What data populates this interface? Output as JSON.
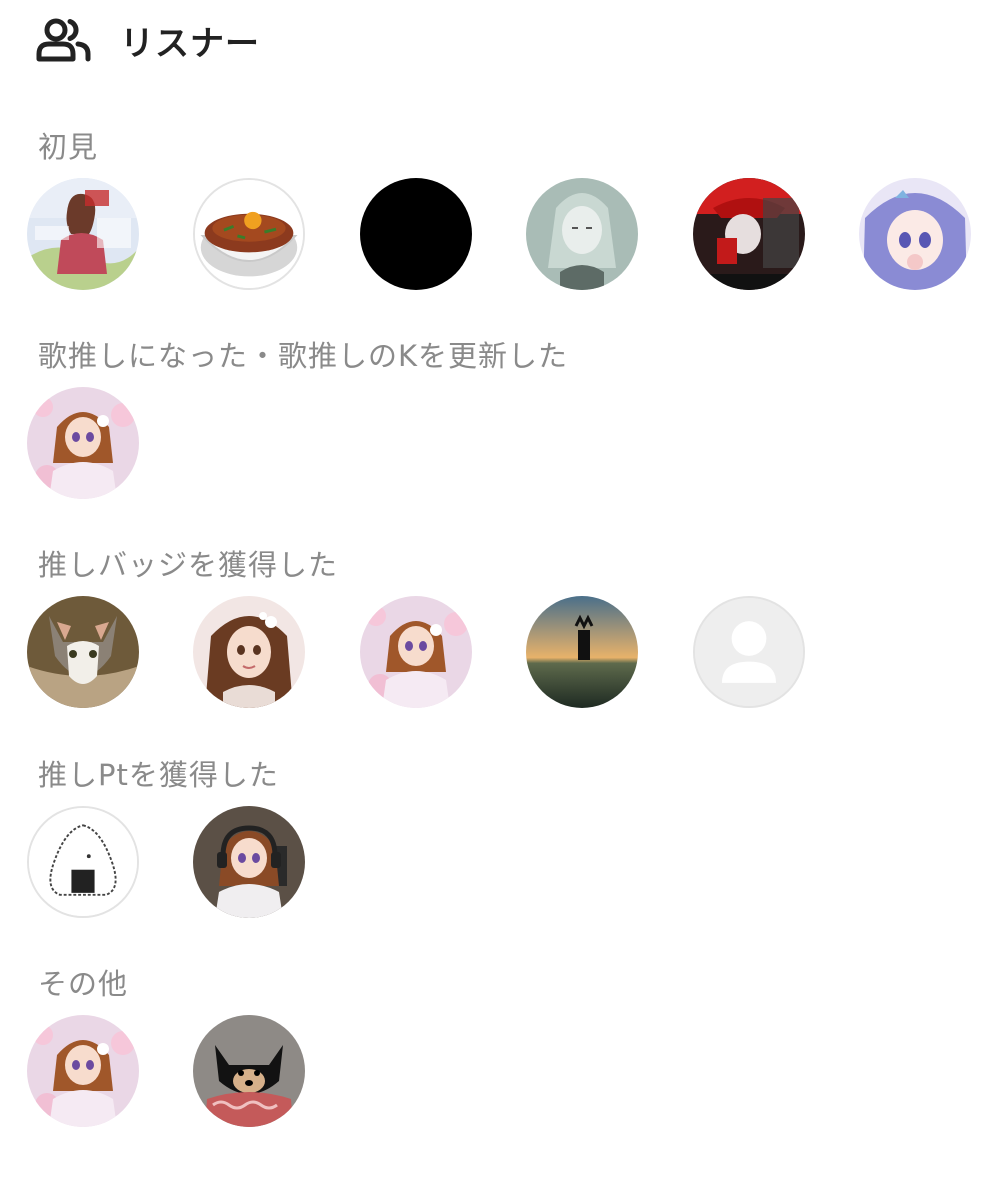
{
  "header": {
    "title": "リスナー",
    "icon": "users-icon"
  },
  "sections": [
    {
      "title": "初見",
      "avatars": [
        "anime-girl-poster",
        "gyudon-bowl",
        "black-circle",
        "grey-anime-girl",
        "red-poster-character",
        "purple-hair-anime-girl"
      ]
    },
    {
      "title": "歌推しになった・歌推しのKを更新した",
      "avatars": [
        "anime-girl-cherry-blossom"
      ]
    },
    {
      "title": "推しバッジを獲得した",
      "avatars": [
        "cat-photo",
        "anime-girl-brown-hair",
        "anime-girl-cherry-blossom",
        "sunset-silhouette",
        "default-user-icon"
      ]
    },
    {
      "title": "推しPtを獲得した",
      "avatars": [
        "onigiri-illustration",
        "anime-girl-headphones"
      ]
    },
    {
      "title": "その他",
      "avatars": [
        "anime-girl-cherry-blossom",
        "black-dog-photo"
      ]
    }
  ],
  "colors": {
    "section_title": "#8a8a8a",
    "header_title": "#222222",
    "avatar_border": "#e3e3e3"
  }
}
